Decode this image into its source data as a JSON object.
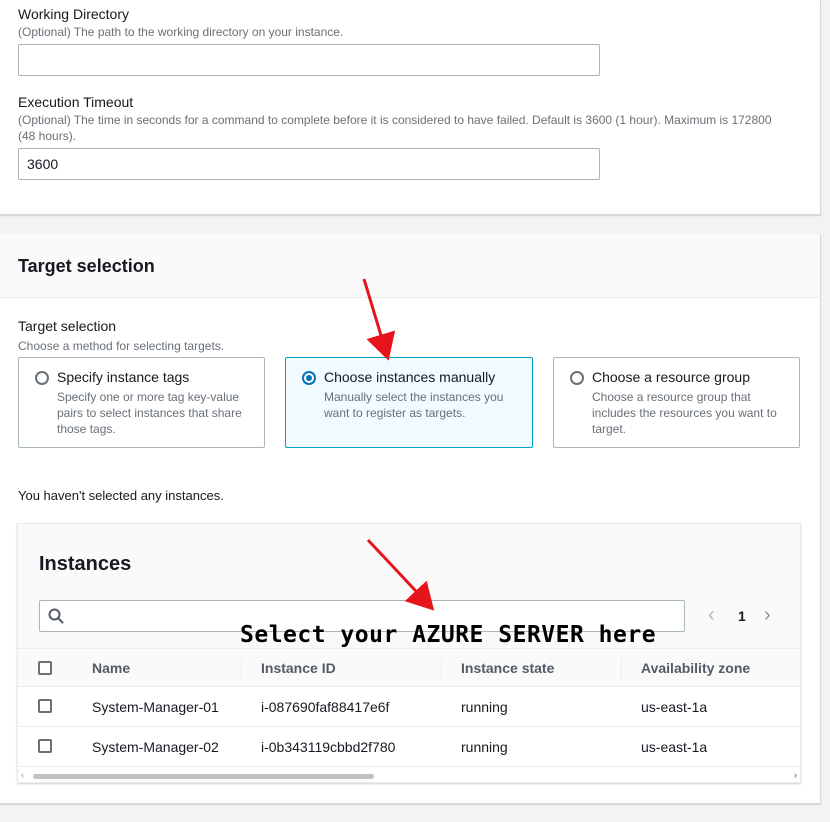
{
  "working_directory": {
    "label": "Working Directory",
    "description": "(Optional) The path to the working directory on your instance.",
    "value": ""
  },
  "execution_timeout": {
    "label": "Execution Timeout",
    "description_line1": "(Optional) The time in seconds for a command to complete before it is considered to have failed. Default is 3600 (1 hour). Maximum is 172800",
    "description_line2": "(48 hours).",
    "value": "3600"
  },
  "target_selection": {
    "panel_title": "Target selection",
    "label": "Target selection",
    "description": "Choose a method for selecting targets.",
    "options": [
      {
        "title": "Specify instance tags",
        "description": "Specify one or more tag key-value pairs to select instances that share those tags.",
        "selected": false
      },
      {
        "title": "Choose instances manually",
        "description": "Manually select the instances you want to register as targets.",
        "selected": true
      },
      {
        "title": "Choose a resource group",
        "description": "Choose a resource group that includes the resources you want to target.",
        "selected": false
      }
    ],
    "status": "You haven't selected any instances."
  },
  "instances": {
    "title": "Instances",
    "search_value": "",
    "pagination": {
      "prev": "‹",
      "page": "1",
      "next": "›"
    },
    "columns": [
      "Name",
      "Instance ID",
      "Instance state",
      "Availability zone"
    ],
    "rows": [
      {
        "name": "System-Manager-01",
        "instance_id": "i-087690faf88417e6f",
        "state": "running",
        "zone": "us-east-1a"
      },
      {
        "name": "System-Manager-02",
        "instance_id": "i-0b343119cbbd2f780",
        "state": "running",
        "zone": "us-east-1a"
      }
    ]
  },
  "annotation": {
    "text": "Select your AZURE SERVER here",
    "arrow_color": "#e8141b"
  }
}
